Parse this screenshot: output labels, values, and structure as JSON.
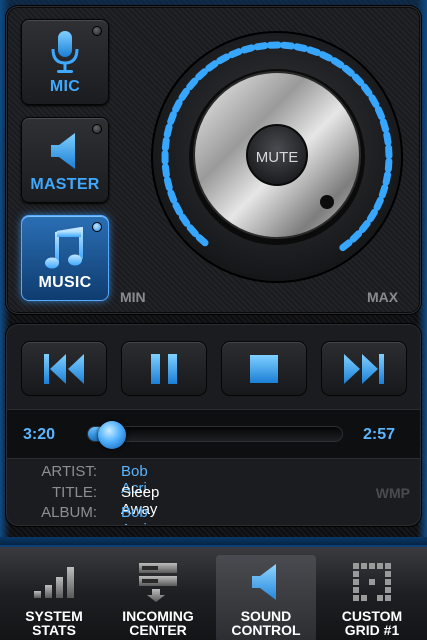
{
  "sources": {
    "mic": {
      "label": "MIC",
      "icon": "microphone-icon"
    },
    "master": {
      "label": "MASTER",
      "icon": "speaker-icon"
    },
    "music": {
      "label": "MUSIC",
      "icon": "music-note-icon",
      "active": true
    }
  },
  "knob": {
    "center_label": "MUTE",
    "min_label": "MIN",
    "max_label": "MAX",
    "level": 1.0
  },
  "transport": {
    "previous_icon": "skip-previous-icon",
    "pause_icon": "pause-icon",
    "stop_icon": "stop-icon",
    "next_icon": "skip-next-icon"
  },
  "progress": {
    "elapsed": "3:20",
    "total": "2:57",
    "fraction": 0.04
  },
  "track": {
    "artist_label": "ARTIST:",
    "artist": "Bob Acri",
    "title_label": "TITLE:",
    "title": "Sleep Away",
    "album_label": "ALBUM:",
    "album": "Bob Acri",
    "player": "WMP"
  },
  "tabs": [
    {
      "line1": "SYSTEM",
      "line2": "STATS",
      "icon": "bar-chart-icon"
    },
    {
      "line1": "INCOMING",
      "line2": "CENTER",
      "icon": "server-download-icon"
    },
    {
      "line1": "SOUND",
      "line2": "CONTROL",
      "icon": "speaker-icon",
      "active": true
    },
    {
      "line1": "CUSTOM",
      "line2": "GRID #1",
      "icon": "grid-icon"
    }
  ],
  "colors": {
    "accent": "#3fa9ff",
    "active_button": "#2a6fb4",
    "text_muted": "#8d8e93"
  }
}
